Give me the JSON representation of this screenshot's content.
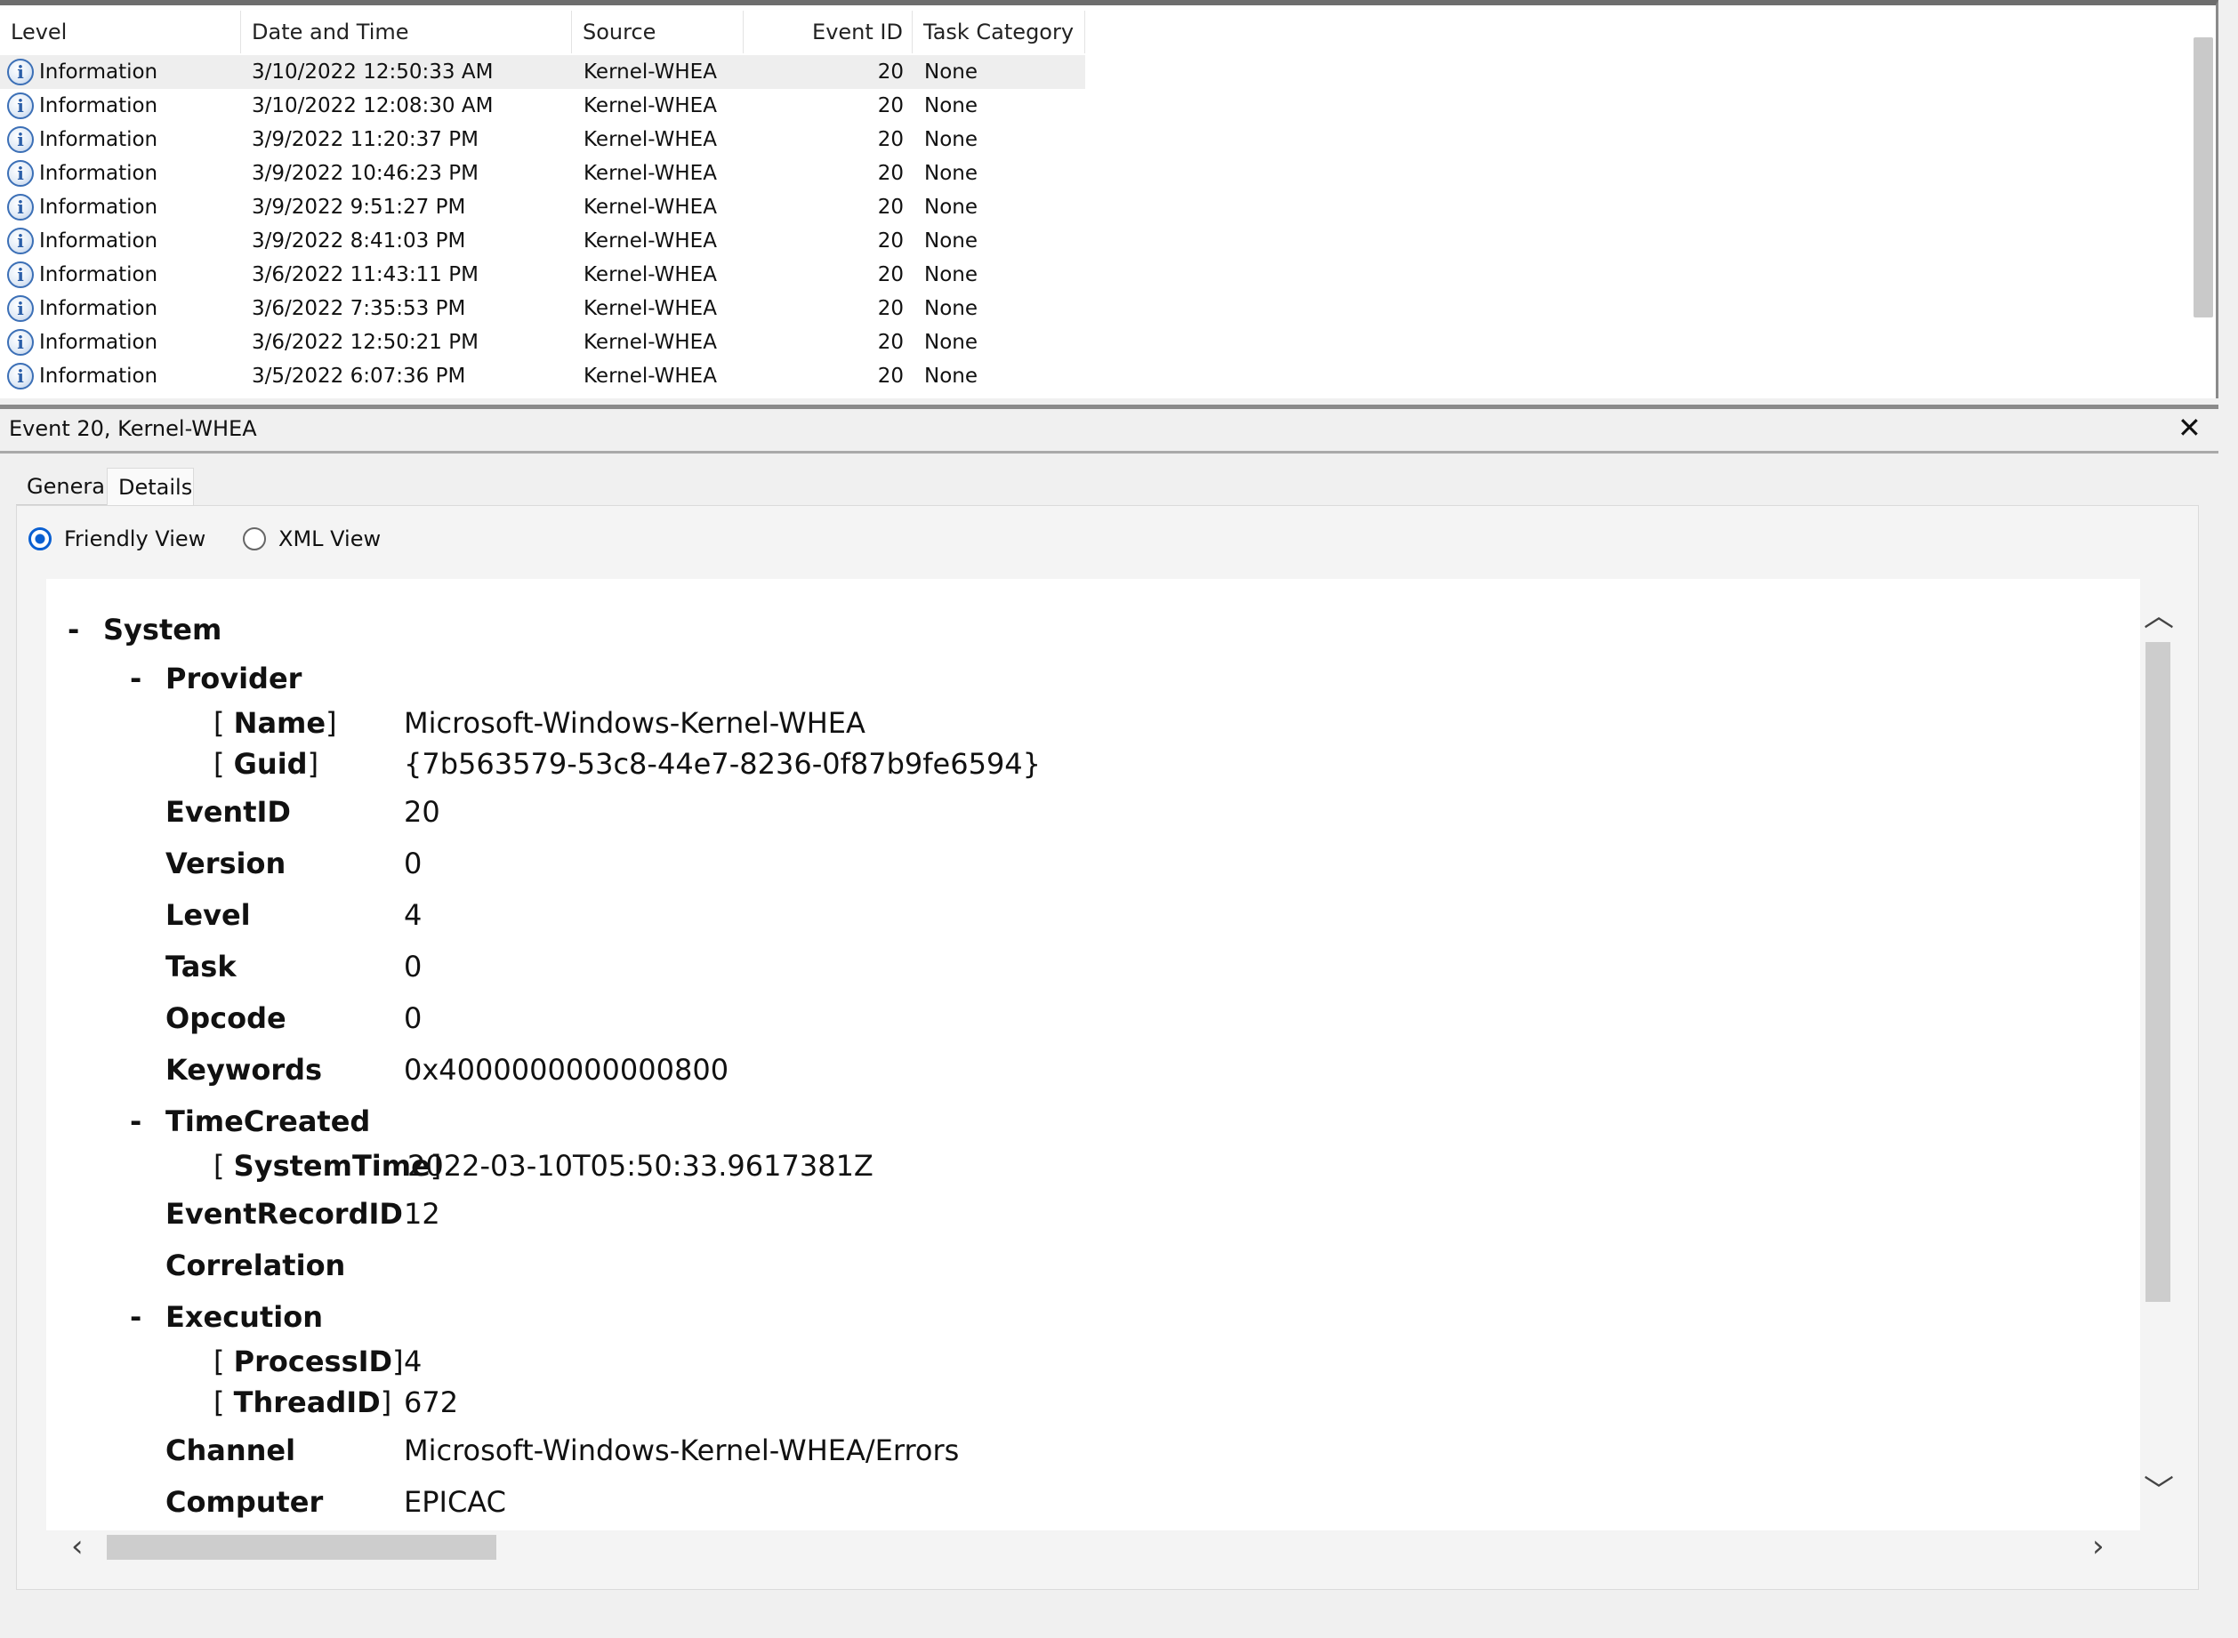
{
  "event_list": {
    "columns": {
      "level": "Level",
      "date_time": "Date and Time",
      "source": "Source",
      "event_id": "Event ID",
      "task_category": "Task Category"
    },
    "rows": [
      {
        "level": "Information",
        "date_time": "3/10/2022 12:50:33 AM",
        "source": "Kernel-WHEA",
        "event_id": "20",
        "task_category": "None"
      },
      {
        "level": "Information",
        "date_time": "3/10/2022 12:08:30 AM",
        "source": "Kernel-WHEA",
        "event_id": "20",
        "task_category": "None"
      },
      {
        "level": "Information",
        "date_time": "3/9/2022 11:20:37 PM",
        "source": "Kernel-WHEA",
        "event_id": "20",
        "task_category": "None"
      },
      {
        "level": "Information",
        "date_time": "3/9/2022 10:46:23 PM",
        "source": "Kernel-WHEA",
        "event_id": "20",
        "task_category": "None"
      },
      {
        "level": "Information",
        "date_time": "3/9/2022 9:51:27 PM",
        "source": "Kernel-WHEA",
        "event_id": "20",
        "task_category": "None"
      },
      {
        "level": "Information",
        "date_time": "3/9/2022 8:41:03 PM",
        "source": "Kernel-WHEA",
        "event_id": "20",
        "task_category": "None"
      },
      {
        "level": "Information",
        "date_time": "3/6/2022 11:43:11 PM",
        "source": "Kernel-WHEA",
        "event_id": "20",
        "task_category": "None"
      },
      {
        "level": "Information",
        "date_time": "3/6/2022 7:35:53 PM",
        "source": "Kernel-WHEA",
        "event_id": "20",
        "task_category": "None"
      },
      {
        "level": "Information",
        "date_time": "3/6/2022 12:50:21 PM",
        "source": "Kernel-WHEA",
        "event_id": "20",
        "task_category": "None"
      },
      {
        "level": "Information",
        "date_time": "3/5/2022 6:07:36 PM",
        "source": "Kernel-WHEA",
        "event_id": "20",
        "task_category": "None"
      }
    ]
  },
  "event_detail": {
    "title": "Event 20, Kernel-WHEA",
    "close_icon": "close-icon",
    "tabs": {
      "general": "General",
      "details": "Details"
    },
    "view_options": {
      "friendly": "Friendly View",
      "xml": "XML View",
      "selected": "Friendly View"
    },
    "tree": {
      "collapse": "-",
      "open_bracket": "[",
      "close_bracket": "]",
      "system": "System",
      "provider": "Provider",
      "name_key": "Name",
      "name_val": "Microsoft-Windows-Kernel-WHEA",
      "guid_key": "Guid",
      "guid_val": "{7b563579-53c8-44e7-8236-0f87b9fe6594}",
      "eventid_key": "EventID",
      "eventid_val": "20",
      "version_key": "Version",
      "version_val": "0",
      "level_key": "Level",
      "level_val": "4",
      "task_key": "Task",
      "task_val": "0",
      "opcode_key": "Opcode",
      "opcode_val": "0",
      "keywords_key": "Keywords",
      "keywords_val": "0x4000000000000800",
      "timecreated": "TimeCreated",
      "systemtime_key": "SystemTime",
      "systemtime_val": "2022-03-10T05:50:33.9617381Z",
      "recordid_key": "EventRecordID",
      "recordid_val": "12",
      "correlation_key": "Correlation",
      "execution": "Execution",
      "processid_key": "ProcessID",
      "processid_val": "4",
      "threadid_key": "ThreadID",
      "threadid_val": "672",
      "channel_key": "Channel",
      "channel_val": "Microsoft-Windows-Kernel-WHEA/Errors",
      "computer_key": "Computer",
      "computer_val": "EPICAC"
    }
  }
}
